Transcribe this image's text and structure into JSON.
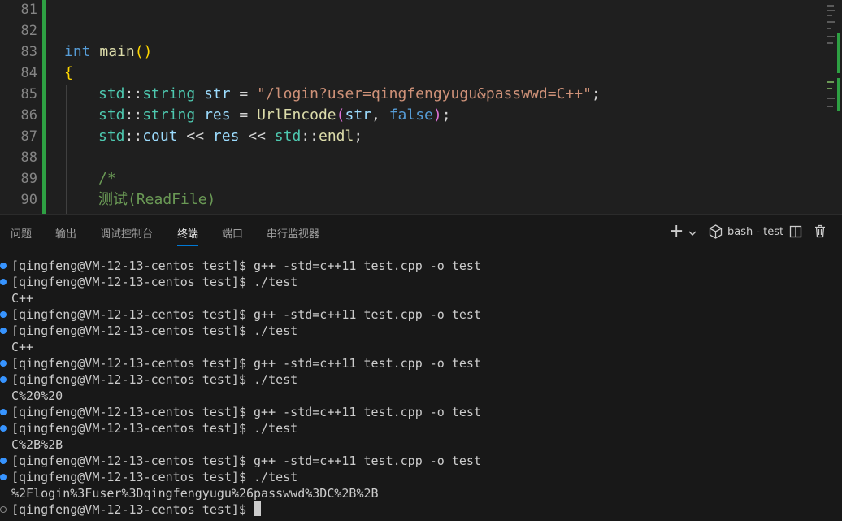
{
  "editor": {
    "lines": [
      {
        "n": "81",
        "text": ""
      },
      {
        "n": "82",
        "text": ""
      },
      {
        "n": "83",
        "text": "int main()"
      },
      {
        "n": "84",
        "text": "{"
      },
      {
        "n": "85",
        "text": "std::string str = \"/login?user=qingfengyugu&passwwd=C++\";"
      },
      {
        "n": "86",
        "text": "std::string res = UrlEncode(str, false);"
      },
      {
        "n": "87",
        "text": "std::cout << res << std::endl;"
      },
      {
        "n": "88",
        "text": ""
      },
      {
        "n": "89",
        "text": "/*"
      },
      {
        "n": "90",
        "text": "测试(ReadFile)"
      }
    ]
  },
  "panel": {
    "tabs": [
      "问题",
      "输出",
      "调试控制台",
      "终端",
      "端口",
      "串行监视器"
    ],
    "active_tab": "终端",
    "terminal_name": "bash - test"
  },
  "terminal": {
    "lines": [
      {
        "text": "[qingfeng@VM-12-13-centos test]$ g++ -std=c++11 test.cpp -o test",
        "marker": "blue"
      },
      {
        "text": "[qingfeng@VM-12-13-centos test]$ ./test",
        "marker": "blue"
      },
      {
        "text": "C++",
        "marker": ""
      },
      {
        "text": "[qingfeng@VM-12-13-centos test]$ g++ -std=c++11 test.cpp -o test",
        "marker": "blue"
      },
      {
        "text": "[qingfeng@VM-12-13-centos test]$ ./test",
        "marker": "blue"
      },
      {
        "text": "C++",
        "marker": ""
      },
      {
        "text": "[qingfeng@VM-12-13-centos test]$ g++ -std=c++11 test.cpp -o test",
        "marker": "blue"
      },
      {
        "text": "[qingfeng@VM-12-13-centos test]$ ./test",
        "marker": "blue"
      },
      {
        "text": "C%20%20",
        "marker": ""
      },
      {
        "text": "[qingfeng@VM-12-13-centos test]$ g++ -std=c++11 test.cpp -o test",
        "marker": "blue"
      },
      {
        "text": "[qingfeng@VM-12-13-centos test]$ ./test",
        "marker": "blue"
      },
      {
        "text": "C%2B%2B",
        "marker": ""
      },
      {
        "text": "[qingfeng@VM-12-13-centos test]$ g++ -std=c++11 test.cpp -o test",
        "marker": "blue"
      },
      {
        "text": "[qingfeng@VM-12-13-centos test]$ ./test",
        "marker": "blue"
      },
      {
        "text": "%2Flogin%3Fuser%3Dqingfengyugu%26passwwd%3DC%2B%2B",
        "marker": ""
      },
      {
        "text": "[qingfeng@VM-12-13-centos test]$ ",
        "marker": "hollow"
      }
    ]
  },
  "icons": {
    "new_terminal": "plus-icon",
    "dropdown": "chevron-down-icon",
    "terminal_profile": "terminal-cube-icon",
    "split": "split-terminal-icon",
    "kill": "trash-icon"
  },
  "colors": {
    "accent": "#0078d4",
    "git_added": "#2ea043",
    "decoration_blue": "#3794ff"
  }
}
